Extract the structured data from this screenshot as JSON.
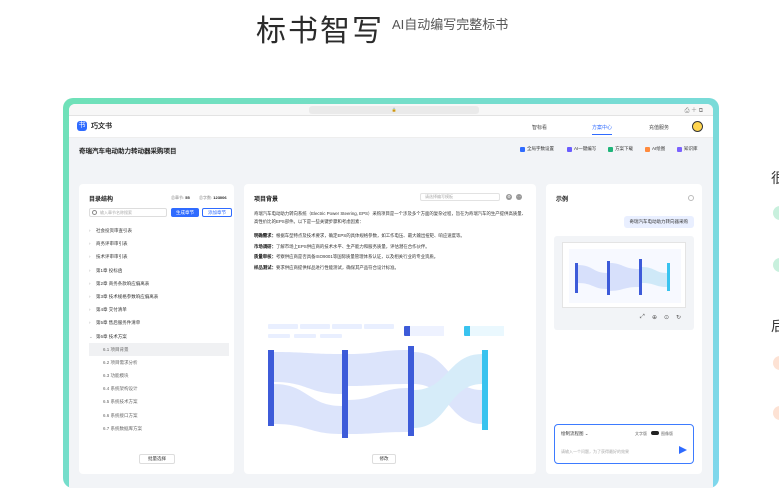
{
  "hero": {
    "title": "标书智写",
    "subtitle": "AI自动编写完整标书"
  },
  "colors": {
    "accent": "#2f6bff",
    "frame_from": "#6fe1b8",
    "frame_to": "#7fd7ec"
  },
  "app": {
    "logo": "巧文书",
    "nav": [
      "智标看",
      "方案中心",
      "充值服务"
    ],
    "active_nav": "方案中心"
  },
  "project": {
    "title": "奇瑞汽车电动助力转动器采购项目",
    "tools": [
      "全局字数设置",
      "AI一键编写",
      "方案下载",
      "AI绘图",
      "知识库"
    ]
  },
  "outline": {
    "title": "目录结构",
    "stats": {
      "sections_label": "总章节:",
      "sections": "55",
      "words_label": "总字数:",
      "words": "123006"
    },
    "search_placeholder": "输入章节名称搜索",
    "gen_button": "生成章节",
    "add_button": "添加章节",
    "items": [
      {
        "label": "社会投资审查引表",
        "level": 0
      },
      {
        "label": "商务评审审引表",
        "level": 0
      },
      {
        "label": "技术评审审引表",
        "level": 0
      },
      {
        "label": "第1章 投标函",
        "level": 0
      },
      {
        "label": "第2章 商务条款响应偏离表",
        "level": 0
      },
      {
        "label": "第3章 技术规格参数响应偏离表",
        "level": 0
      },
      {
        "label": "第4章 交付清单",
        "level": 0
      },
      {
        "label": "第5章 售后服务件清单",
        "level": 0
      },
      {
        "label": "第6章 技术方案",
        "level": 0,
        "open": true
      },
      {
        "label": "6.1 项目背景",
        "level": 1,
        "selected": true
      },
      {
        "label": "6.2 项目需求分析",
        "level": 1
      },
      {
        "label": "6.3 功能模块",
        "level": 1
      },
      {
        "label": "6.4 系统架构设计",
        "level": 1
      },
      {
        "label": "6.5 系统技术方案",
        "level": 1
      },
      {
        "label": "6.6 系统接口方案",
        "level": 1
      },
      {
        "label": "6.7 系统数据库方案",
        "level": 1
      }
    ],
    "batch_button": "批量选择"
  },
  "content": {
    "title": "项目背景",
    "select_placeholder": "请选择编写模板",
    "intro": "奇瑞汽车电动助力转向系统（Electric Power Steering, EPS）采购项目是一个涉及多个方面的复杂过程，旨在为奇瑞汽车的生产提供高质量、高性价比的EPS部件。以下是一些关键步骤和考虑因素：",
    "points": [
      {
        "k": "明确需求：",
        "v": "根据车型特点及技术要求，确定EPS的具体规格参数，如工作电压、最大输出扭矩、响应速度等。"
      },
      {
        "k": "市场调研：",
        "v": "了解市场上EPS供应商的技术水平、生产能力和服务质量，评估潜在合作伙伴。"
      },
      {
        "k": "质量审核：",
        "v": "考察供应商是否具备ISO9001等国际质量管理体系认证，以及相关行业的专业资质。"
      },
      {
        "k": "样品测试：",
        "v": "要求供应商提供样品进行性能测试，确保其产品符合设计标准。"
      }
    ],
    "edit_button": "修改"
  },
  "example": {
    "title": "示例",
    "bubble": "奇瑞汽车电动助力转向器采购",
    "mode": "绘制流程图",
    "mode_opt": "文字版",
    "mode_opt2": "图像版",
    "input_placeholder": "请输入一个问题，为了获得最好的效果"
  },
  "side": {
    "labels": [
      "很",
      "后"
    ]
  }
}
